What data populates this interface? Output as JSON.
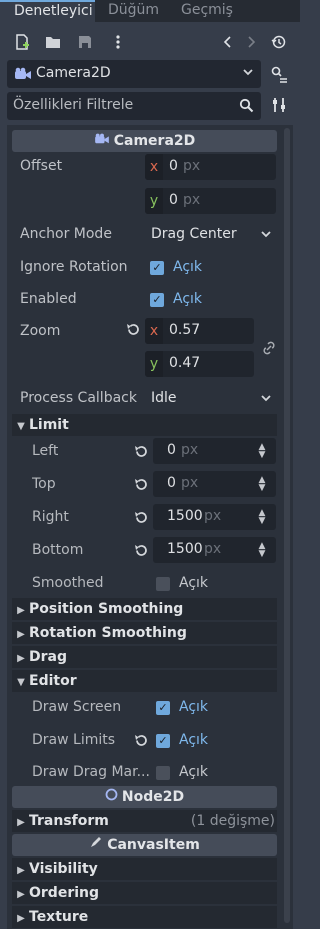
{
  "tabs": [
    {
      "label": "Denetleyici"
    },
    {
      "label": "Düğüm"
    },
    {
      "label": "Geçmiş"
    }
  ],
  "toolbar": {
    "icons": [
      "new-resource-icon",
      "open-folder-icon",
      "save-icon",
      "more-vert-icon",
      "history-back-icon",
      "history-forward-icon",
      "history-list-icon"
    ]
  },
  "object": {
    "name": "Camera2D"
  },
  "filter": {
    "placeholder": "Özellikleri Filtrele"
  },
  "camera2d": {
    "header": "Camera2D",
    "offset_label": "Offset",
    "offset_x": "0",
    "offset_y": "0",
    "unit_px": "px",
    "anchor_label": "Anchor Mode",
    "anchor_value": "Drag Center",
    "ignore_rotation_label": "Ignore Rotation",
    "ignore_rotation_value": "Açık",
    "enabled_label": "Enabled",
    "enabled_value": "Açık",
    "zoom_label": "Zoom",
    "zoom_x": "0.57",
    "zoom_y": "0.47",
    "process_label": "Process Callback",
    "process_value": "Idle"
  },
  "limit": {
    "header": "Limit",
    "left_label": "Left",
    "left_value": "0",
    "top_label": "Top",
    "top_value": "0",
    "right_label": "Right",
    "right_value": "1500",
    "bottom_label": "Bottom",
    "bottom_value": "1500",
    "smoothed_label": "Smoothed",
    "smoothed_value": "Açık"
  },
  "groups": {
    "position_smoothing": "Position Smoothing",
    "rotation_smoothing": "Rotation Smoothing",
    "drag": "Drag",
    "editor": "Editor"
  },
  "editor": {
    "draw_screen_label": "Draw Screen",
    "draw_screen_value": "Açık",
    "draw_limits_label": "Draw Limits",
    "draw_limits_value": "Açık",
    "draw_drag_label": "Draw Drag Mar...",
    "draw_drag_value": "Açık"
  },
  "node2d": {
    "header": "Node2D",
    "transform_label": "Transform",
    "transform_changes": "(1 değişme)"
  },
  "canvasitem": {
    "header": "CanvasItem",
    "visibility": "Visibility",
    "ordering": "Ordering",
    "texture": "Texture"
  }
}
